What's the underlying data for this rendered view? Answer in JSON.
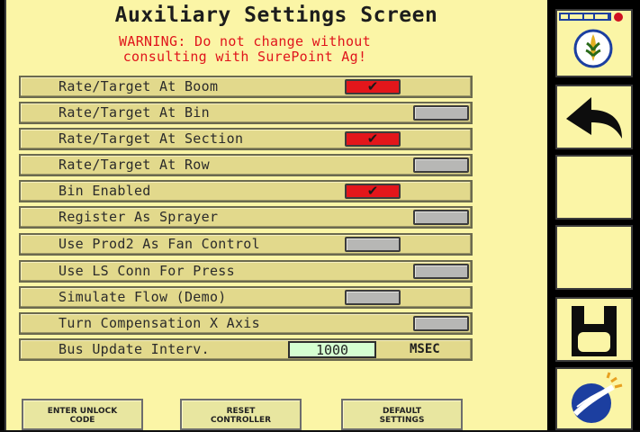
{
  "title": "Auxiliary Settings Screen",
  "warning": {
    "line1": "WARNING: Do not change without",
    "line2": "consulting with SurePoint Ag!"
  },
  "settings": [
    {
      "label": "Rate/Target At Boom",
      "checked": true
    },
    {
      "label": "Rate/Target At Bin",
      "checked": false
    },
    {
      "label": "Rate/Target At Section",
      "checked": true
    },
    {
      "label": "Rate/Target At Row",
      "checked": false
    },
    {
      "label": "Bin Enabled",
      "checked": true
    },
    {
      "label": "Register As Sprayer",
      "checked": false
    },
    {
      "label": "Use Prod2 As Fan Control",
      "checked": false
    },
    {
      "label": "Use LS Conn For Press",
      "checked": false
    },
    {
      "label": "Simulate Flow (Demo)",
      "checked": false
    },
    {
      "label": "Turn Compensation X Axis",
      "checked": false
    }
  ],
  "bus_update": {
    "label": "Bus Update Interv.",
    "value": "1000",
    "unit": "MSEC"
  },
  "buttons": {
    "enter_unlock": [
      "ENTER UNLOCK",
      "CODE"
    ],
    "reset": [
      "RESET",
      "CONTROLLER"
    ],
    "default": [
      "DEFAULT",
      "SETTINGS"
    ]
  },
  "checkmark": "✔",
  "colors": {
    "panel": "#fbf5a6",
    "row": "#e2d98c",
    "checked": "#e3161b",
    "unchecked": "#b7b7b5",
    "warning": "#e0151c",
    "value_box": "#d5ffd1"
  },
  "side_icons": [
    "logo-icon",
    "back-arrow-icon",
    "blank-button",
    "blank-button",
    "save-icon",
    "satellite-icon"
  ]
}
